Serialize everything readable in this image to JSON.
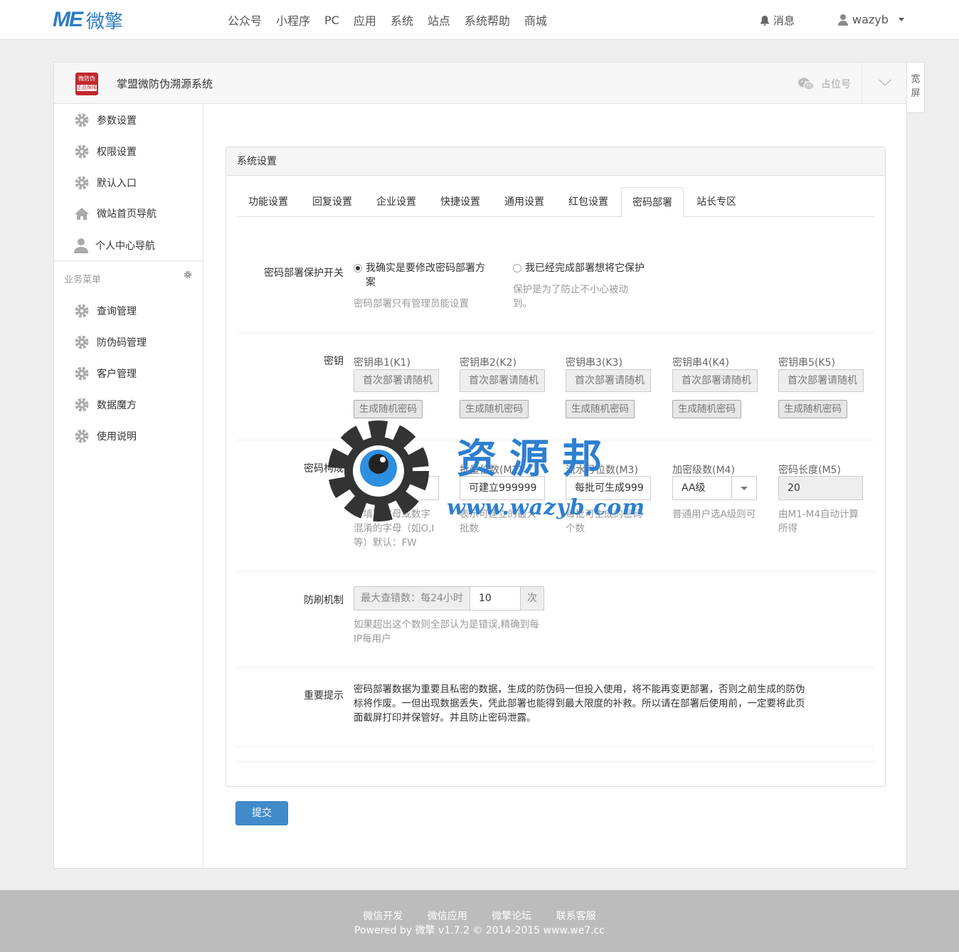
{
  "header": {
    "logo_me": "ME",
    "logo_cn": "微擎",
    "nav": [
      "公众号",
      "小程序",
      "PC",
      "应用",
      "系统",
      "站点",
      "系统帮助",
      "商城"
    ],
    "messages": "消息",
    "username": "wazyb"
  },
  "app": {
    "icon_top": "微防伪",
    "icon_bottom": "正品保障",
    "title": "掌盟微防伪溯源系统",
    "placeholder": "占位号",
    "wide_screen": "宽屏"
  },
  "sidebar": {
    "items": [
      "参数设置",
      "权限设置",
      "默认入口",
      "微站首页导航",
      "个人中心导航"
    ],
    "group_title": "业务菜单",
    "biz_items": [
      "查询管理",
      "防伪码管理",
      "客户管理",
      "数据魔方",
      "使用说明"
    ]
  },
  "settings": {
    "panel_title": "系统设置",
    "tabs": [
      "功能设置",
      "回复设置",
      "企业设置",
      "快捷设置",
      "通用设置",
      "红包设置",
      "密码部署",
      "站长专区"
    ],
    "active_tab": "密码部署",
    "protect": {
      "label": "密码部署保护开关",
      "option1": "我确实是要修改密码部署方案",
      "option1_hint": "密码部署只有管理员能设置",
      "option2": "我已经完成部署想将它保护",
      "option2_hint": "保护是为了防止不小心被动到。"
    },
    "keys": {
      "label": "密钥",
      "items": [
        {
          "name": "密钥串1(K1)",
          "value": "首次部署请随机",
          "button": "生成随机密码"
        },
        {
          "name": "密钥串2(K2)",
          "value": "首次部署请随机",
          "button": "生成随机密码"
        },
        {
          "name": "密钥串3(K3)",
          "value": "首次部署请随机",
          "button": "生成随机密码"
        },
        {
          "name": "密钥串4(K4)",
          "value": "首次部署请随机",
          "button": "生成随机密码"
        },
        {
          "name": "密钥串5(K5)",
          "value": "首次部署请随机",
          "button": "生成随机密码"
        }
      ]
    },
    "structure": {
      "label": "密码构成",
      "items": [
        {
          "name": "前缀(M1)",
          "value": "FW",
          "hint": "可填写字母或数字混淆的字母（如O,I 等）默认：FW"
        },
        {
          "name": "批量位数(M2)",
          "value": "可建立999999",
          "hint": "表示可建立的最大批数"
        },
        {
          "name": "流水号位数(M3)",
          "value": "每批可生成999",
          "hint": "每批可生成的密码个数"
        },
        {
          "name": "加密级数(M4)",
          "value": "AA级",
          "hint": "普通用户选A级则可"
        },
        {
          "name": "密码长度(M5)",
          "value": "20",
          "hint": "由M1-M4自动计算所得"
        }
      ]
    },
    "anti_brush": {
      "label": "防刷机制",
      "prefix": "最大查错数：每24小时",
      "value": "10",
      "suffix": "次",
      "hint": "如果超出这个数则全部认为是错误,精确到每IP每用户"
    },
    "notice": {
      "label": "重要提示",
      "text": "密码部署数据为重要且私密的数据，生成的防伪码一但投入使用，将不能再变更部署，否则之前生成的防伪标将作废。一但出现数据丢失，凭此部署也能得到最大限度的补救。所以请在部署后使用前，一定要将此页面截屏打印并保管好。并且防止密码泄露。"
    },
    "submit": "提交"
  },
  "watermark": {
    "text": "资源邦",
    "url": "www.wazyb.com"
  },
  "footer": {
    "links": [
      "微信开发",
      "微信应用",
      "微擎论坛",
      "联系客服"
    ],
    "copyright": "Powered by 微擎 v1.7.2 © 2014-2015 www.we7.cc"
  },
  "colors": {
    "brand": "#2e7bc4",
    "primary_button": "#428bca",
    "footer_bg": "#bcbcbc"
  }
}
